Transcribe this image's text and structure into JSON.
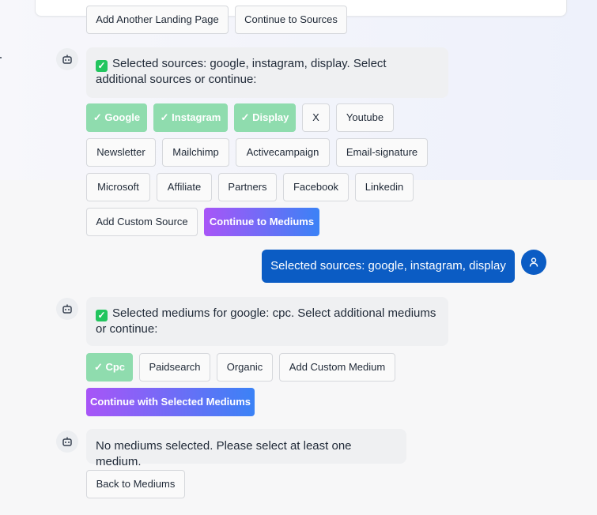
{
  "top_buttons": {
    "add_landing": "Add Another Landing Page",
    "continue_sources": "Continue to Sources"
  },
  "sources_message": {
    "text": "Selected sources: google, instagram, display. Select additional sources or continue:"
  },
  "sources": {
    "selected": [
      "✓ Google",
      "✓ Instagram",
      "✓ Display"
    ],
    "options": [
      "X",
      "Youtube",
      "Newsletter",
      "Mailchimp",
      "Activecampaign",
      "Email-signature",
      "Microsoft",
      "Affiliate",
      "Partners",
      "Facebook",
      "Linkedin"
    ],
    "add_custom": "Add Custom Source",
    "continue": "Continue to Mediums"
  },
  "user_message": {
    "text": "Selected sources: google, instagram, display"
  },
  "mediums_message": {
    "text": "Selected mediums for google: cpc. Select additional mediums or continue:"
  },
  "mediums": {
    "selected": [
      "✓ Cpc"
    ],
    "options": [
      "Paidsearch",
      "Organic"
    ],
    "add_custom": "Add Custom Medium",
    "continue": "Continue with Selected Mediums"
  },
  "error_message": {
    "text": "No mediums selected. Please select at least one medium."
  },
  "back_button": "Back to Mediums",
  "colors": {
    "selected_chip": "#8fdcae",
    "user_bubble": "#0b5cc4",
    "gradient_start": "#a855f7",
    "gradient_end": "#3b82f6"
  },
  "icons": {
    "bot": "robot-icon",
    "user": "user-icon",
    "check": "checkbox-check-icon"
  }
}
